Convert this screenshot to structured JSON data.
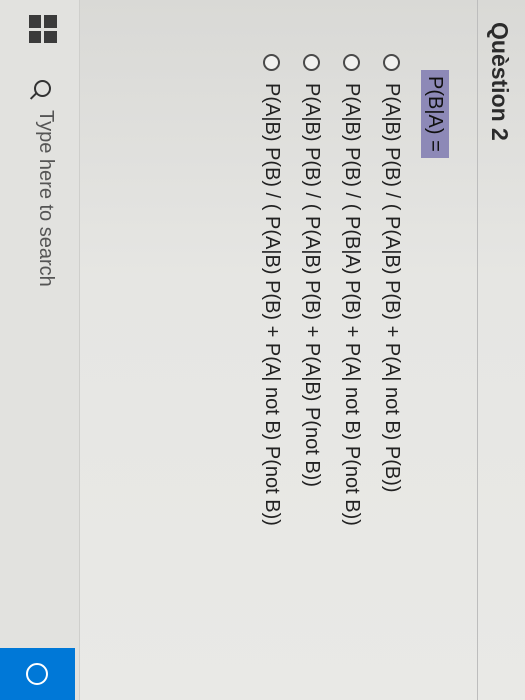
{
  "question": {
    "title": "Quèstion 2",
    "prompt": "P(B|A) ="
  },
  "options": [
    "P(A|B) P(B)  /  ( P(A|B) P(B)  + P(A| not B) P(B))",
    "P(A|B) P(B)  /  ( P(B|A) P(B)  + P(A| not B) P(not B))",
    "P(A|B) P(B)  /  ( P(A|B) P(B)  + P(A|B) P(not B))",
    "P(A|B) P(B)  /  ( P(A|B) P(B)  + P(A| not B) P(not B))"
  ],
  "taskbar": {
    "search_placeholder": "Type here to search"
  }
}
